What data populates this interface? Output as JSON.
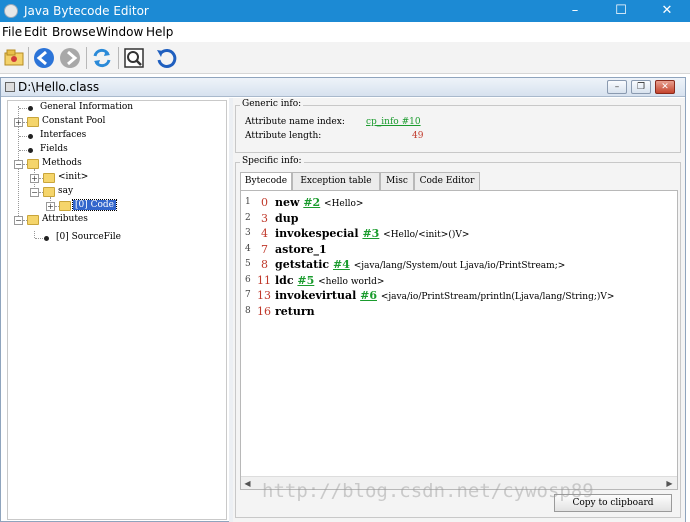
{
  "window": {
    "title": "Java Bytecode Editor"
  },
  "menu": [
    "File",
    "Edit",
    "Browse",
    "Window",
    "Help"
  ],
  "frame": {
    "title": "D:\\Hello.class"
  },
  "tree": {
    "general_information": "General Information",
    "constant_pool": "Constant Pool",
    "interfaces": "Interfaces",
    "fields": "Fields",
    "methods": "Methods",
    "init": "<init>",
    "say": "say",
    "code": "[0] Code",
    "attributes": "Attributes",
    "source_file": "[0] SourceFile"
  },
  "generic_info": {
    "title": "Generic info:",
    "name_index_label": "Attribute name index:",
    "name_index_value": "cp_info #10",
    "length_label": "Attribute length:",
    "length_value": "49"
  },
  "specific_info": {
    "title": "Specific info:"
  },
  "tabs": [
    "Bytecode",
    "Exception table",
    "Misc",
    "Code Editor"
  ],
  "bytecode": [
    {
      "line": "1",
      "offset": "0",
      "op": "new",
      "ref": "#2",
      "arg": "<Hello>"
    },
    {
      "line": "2",
      "offset": "3",
      "op": "dup",
      "ref": "",
      "arg": ""
    },
    {
      "line": "3",
      "offset": "4",
      "op": "invokespecial",
      "ref": "#3",
      "arg": "<Hello/<init>()V>"
    },
    {
      "line": "4",
      "offset": "7",
      "op": "astore_1",
      "ref": "",
      "arg": ""
    },
    {
      "line": "5",
      "offset": "8",
      "op": "getstatic",
      "ref": "#4",
      "arg": "<java/lang/System/out Ljava/io/PrintStream;>"
    },
    {
      "line": "6",
      "offset": "11",
      "op": "ldc",
      "ref": "#5",
      "arg": "<hello world>"
    },
    {
      "line": "7",
      "offset": "13",
      "op": "invokevirtual",
      "ref": "#6",
      "arg": "<java/io/PrintStream/println(Ljava/lang/String;)V>"
    },
    {
      "line": "8",
      "offset": "16",
      "op": "return",
      "ref": "",
      "arg": ""
    }
  ],
  "copy_button": "Copy to clipboard",
  "watermark": "http://blog.csdn.net/cywosp89",
  "colors": {
    "titlebar": "#1c8ad4",
    "offset": "#c0392b",
    "reference": "#1a9b2d",
    "selection": "#3366cc"
  }
}
